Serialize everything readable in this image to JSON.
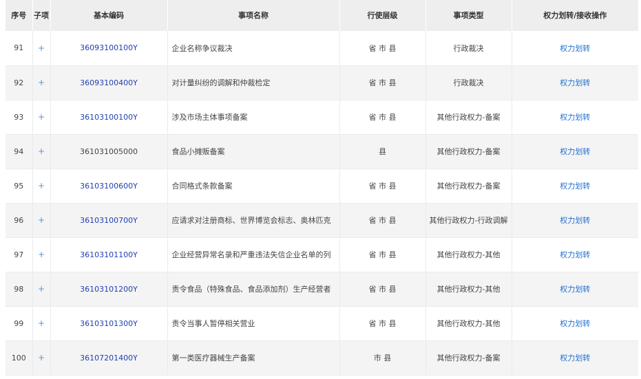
{
  "header": {
    "seq": "序号",
    "sub": "子项",
    "code": "基本编码",
    "name": "事项名称",
    "level": "行使层级",
    "type": "事项类型",
    "op": "权力划转/接收操作"
  },
  "rows": [
    {
      "seq": "91",
      "sub": "+",
      "code": "36093100100Y",
      "code_link": true,
      "name": "企业名称争议裁决",
      "level": "省 市 县",
      "type": "行政裁决",
      "op": "权力划转"
    },
    {
      "seq": "92",
      "sub": "+",
      "code": "36093100400Y",
      "code_link": true,
      "name": "对计量纠纷的调解和仲裁检定",
      "level": "省 市 县",
      "type": "行政裁决",
      "op": "权力划转"
    },
    {
      "seq": "93",
      "sub": "+",
      "code": "36103100100Y",
      "code_link": true,
      "name": "涉及市场主体事项备案",
      "level": "省 市 县",
      "type": "其他行政权力-备案",
      "op": "权力划转"
    },
    {
      "seq": "94",
      "sub": "+",
      "code": "361031005000",
      "code_link": false,
      "name": "食品小摊贩备案",
      "level": "县",
      "type": "其他行政权力-备案",
      "op": "权力划转"
    },
    {
      "seq": "95",
      "sub": "+",
      "code": "36103100600Y",
      "code_link": true,
      "name": "合同格式条款备案",
      "level": "省 市 县",
      "type": "其他行政权力-备案",
      "op": "权力划转"
    },
    {
      "seq": "96",
      "sub": "+",
      "code": "36103100700Y",
      "code_link": true,
      "name": "应请求对注册商标、世界博览会标志、奥林匹克",
      "level": "省 市 县",
      "type": "其他行政权力-行政调解",
      "op": "权力划转"
    },
    {
      "seq": "97",
      "sub": "+",
      "code": "36103101100Y",
      "code_link": true,
      "name": "企业经营异常名录和严重违法失信企业名单的列",
      "level": "省 市 县",
      "type": "其他行政权力-其他",
      "op": "权力划转"
    },
    {
      "seq": "98",
      "sub": "+",
      "code": "36103101200Y",
      "code_link": true,
      "name": "责令食品（特殊食品、食品添加剂）生产经营者",
      "level": "省 市 县",
      "type": "其他行政权力-其他",
      "op": "权力划转"
    },
    {
      "seq": "99",
      "sub": "+",
      "code": "36103101300Y",
      "code_link": true,
      "name": "责令当事人暂停相关营业",
      "level": "省 市 县",
      "type": "其他行政权力-其他",
      "op": "权力划转"
    },
    {
      "seq": "100",
      "sub": "+",
      "code": "36107201400Y",
      "code_link": true,
      "name": "第一类医疗器械生产备案",
      "level": "市 县",
      "type": "其他行政权力-备案",
      "op": "权力划转"
    }
  ]
}
